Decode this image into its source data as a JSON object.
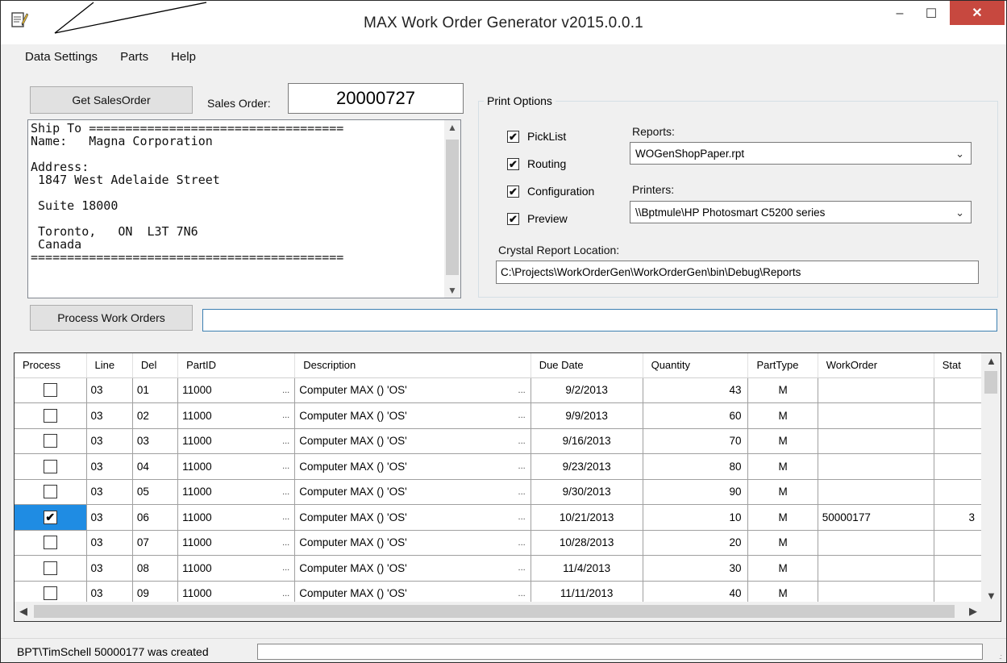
{
  "window": {
    "title": "MAX Work Order Generator  v2015.0.0.1",
    "minimize_glyph": "–",
    "maximize_glyph": "☐",
    "close_glyph": "✕"
  },
  "menu": [
    "Data Settings",
    "Parts",
    "Help"
  ],
  "sales": {
    "get_button": "Get SalesOrder",
    "label": "Sales Order:",
    "value": "20000727"
  },
  "ship_to": {
    "lines": [
      "Ship To ===================================",
      "Name:   Magna Corporation",
      "",
      "Address:",
      " 1847 West Adelaide Street",
      "",
      " Suite 18000",
      "",
      " Toronto,   ON  L3T 7N6",
      " Canada",
      "==========================================="
    ]
  },
  "print_options": {
    "title": "Print Options",
    "checkboxes": [
      {
        "label": "PickList",
        "checked": true
      },
      {
        "label": "Routing",
        "checked": true
      },
      {
        "label": "Configuration",
        "checked": true
      },
      {
        "label": "Preview",
        "checked": true
      }
    ],
    "reports_label": "Reports:",
    "reports_value": "WOGenShopPaper.rpt",
    "printers_label": "Printers:",
    "printers_value": "\\\\Bptmule\\HP Photosmart C5200 series",
    "location_label": "Crystal Report Location:",
    "location_value": "C:\\Projects\\WorkOrderGen\\WorkOrderGen\\bin\\Debug\\Reports"
  },
  "process_button": "Process Work Orders",
  "grid": {
    "columns": [
      "Process",
      "Line",
      "Del",
      "PartID",
      "Description",
      "Due Date",
      "Quantity",
      "PartType",
      "WorkOrder",
      "Stat"
    ],
    "rows": [
      {
        "checked": false,
        "line": "03",
        "del": "01",
        "part": "11000",
        "desc": "Computer MAX () 'OS'",
        "due": "9/2/2013",
        "qty": "43",
        "type": "M",
        "wo": "",
        "stat": ""
      },
      {
        "checked": false,
        "line": "03",
        "del": "02",
        "part": "11000",
        "desc": "Computer MAX () 'OS'",
        "due": "9/9/2013",
        "qty": "60",
        "type": "M",
        "wo": "",
        "stat": ""
      },
      {
        "checked": false,
        "line": "03",
        "del": "03",
        "part": "11000",
        "desc": "Computer MAX () 'OS'",
        "due": "9/16/2013",
        "qty": "70",
        "type": "M",
        "wo": "",
        "stat": ""
      },
      {
        "checked": false,
        "line": "03",
        "del": "04",
        "part": "11000",
        "desc": "Computer MAX () 'OS'",
        "due": "9/23/2013",
        "qty": "80",
        "type": "M",
        "wo": "",
        "stat": ""
      },
      {
        "checked": false,
        "line": "03",
        "del": "05",
        "part": "11000",
        "desc": "Computer MAX () 'OS'",
        "due": "9/30/2013",
        "qty": "90",
        "type": "M",
        "wo": "",
        "stat": ""
      },
      {
        "checked": true,
        "line": "03",
        "del": "06",
        "part": "11000",
        "desc": "Computer MAX () 'OS'",
        "due": "10/21/2013",
        "qty": "10",
        "type": "M",
        "wo": "50000177",
        "stat": "3"
      },
      {
        "checked": false,
        "line": "03",
        "del": "07",
        "part": "11000",
        "desc": "Computer MAX () 'OS'",
        "due": "10/28/2013",
        "qty": "20",
        "type": "M",
        "wo": "",
        "stat": ""
      },
      {
        "checked": false,
        "line": "03",
        "del": "08",
        "part": "11000",
        "desc": "Computer MAX () 'OS'",
        "due": "11/4/2013",
        "qty": "30",
        "type": "M",
        "wo": "",
        "stat": ""
      },
      {
        "checked": false,
        "line": "03",
        "del": "09",
        "part": "11000",
        "desc": "Computer MAX () 'OS'",
        "due": "11/11/2013",
        "qty": "40",
        "type": "M",
        "wo": "",
        "stat": ""
      }
    ],
    "ellipsis": "...",
    "check_glyph": "✔"
  },
  "status": {
    "text": "BPT\\TimSchell  50000177 was created"
  },
  "colors": {
    "selection": "#1f8ce3",
    "close_button": "#c7483f",
    "progress_border": "#3c7fb1"
  },
  "icons": {
    "app": "notepad-pencil-icon",
    "scroll_up": "▲",
    "scroll_down": "▼",
    "combo_arrow": "⌄"
  }
}
